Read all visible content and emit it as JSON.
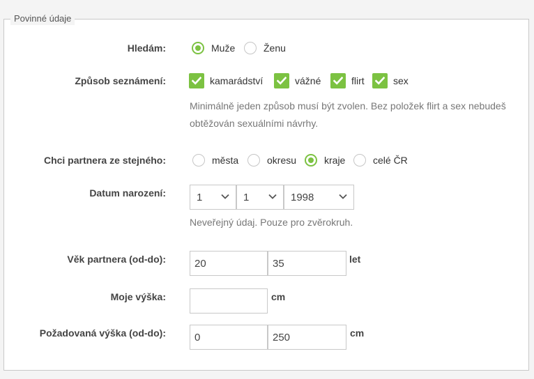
{
  "legend": "Povinné údaje",
  "hledam": {
    "label": "Hledám:",
    "options": [
      {
        "text": "Muže",
        "checked": true
      },
      {
        "text": "Ženu",
        "checked": false
      }
    ]
  },
  "zpusob": {
    "label": "Způsob seznámení:",
    "options": [
      {
        "text": "kamarádství",
        "checked": true
      },
      {
        "text": "vážné",
        "checked": true
      },
      {
        "text": "flirt",
        "checked": true
      },
      {
        "text": "sex",
        "checked": true
      }
    ],
    "hint": "Minimálně jeden způsob musí být zvolen. Bez položek flirt a sex nebudeš obtěžován sexuálními návrhy."
  },
  "partner_from": {
    "label": "Chci partnera ze stejného:",
    "options": [
      {
        "text": "města",
        "checked": false
      },
      {
        "text": "okresu",
        "checked": false
      },
      {
        "text": "kraje",
        "checked": true
      },
      {
        "text": "celé ČR",
        "checked": false
      }
    ]
  },
  "birth": {
    "label": "Datum narození:",
    "day": "1",
    "month": "1",
    "year": "1998",
    "hint": "Neveřejný údaj. Pouze pro zvěrokruh."
  },
  "age_partner": {
    "label": "Věk partnera (od-do):",
    "from": "20",
    "to": "35",
    "unit": "let"
  },
  "height": {
    "label": "Moje výška:",
    "value": "",
    "unit": "cm"
  },
  "height_partner": {
    "label": "Požadovaná výška (od-do):",
    "from": "0",
    "to": "250",
    "unit": "cm"
  },
  "colors": {
    "accent": "#7cc242",
    "border": "#c8c8c8"
  }
}
